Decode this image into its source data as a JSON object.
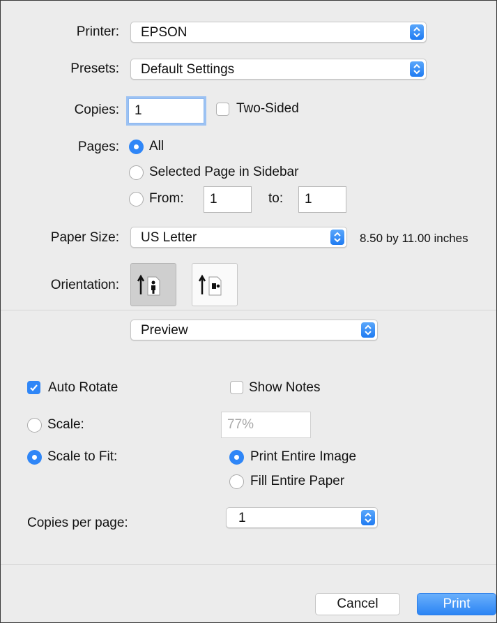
{
  "printer": {
    "label": "Printer:",
    "value": "EPSON"
  },
  "presets": {
    "label": "Presets:",
    "value": "Default Settings"
  },
  "copies": {
    "label": "Copies:",
    "value": "1",
    "two_sided_label": "Two-Sided",
    "two_sided_checked": false
  },
  "pages": {
    "label": "Pages:",
    "options": {
      "all": "All",
      "selected": "Selected Page in Sidebar",
      "from": "From:"
    },
    "selected_option": "All",
    "from_value": "1",
    "to_label": "to:",
    "to_value": "1"
  },
  "paper_size": {
    "label": "Paper Size:",
    "value": "US Letter",
    "dimensions": "8.50 by 11.00 inches"
  },
  "orientation": {
    "label": "Orientation:",
    "options": [
      "portrait",
      "landscape"
    ],
    "selected": "portrait"
  },
  "app_section": {
    "value": "Preview"
  },
  "preview_options": {
    "auto_rotate_label": "Auto Rotate",
    "auto_rotate_checked": true,
    "show_notes_label": "Show Notes",
    "show_notes_checked": false,
    "scale_label": "Scale:",
    "scale_value": "77%",
    "scale_to_fit_label": "Scale to Fit:",
    "scale_mode": "Scale to Fit",
    "print_entire_image_label": "Print Entire Image",
    "fill_entire_paper_label": "Fill Entire Paper",
    "fit_mode": "Print Entire Image",
    "copies_per_page_label": "Copies per page:",
    "copies_per_page_value": "1"
  },
  "buttons": {
    "cancel": "Cancel",
    "print": "Print"
  },
  "colors": {
    "accent": "#2f86f7",
    "background": "#ececec"
  }
}
